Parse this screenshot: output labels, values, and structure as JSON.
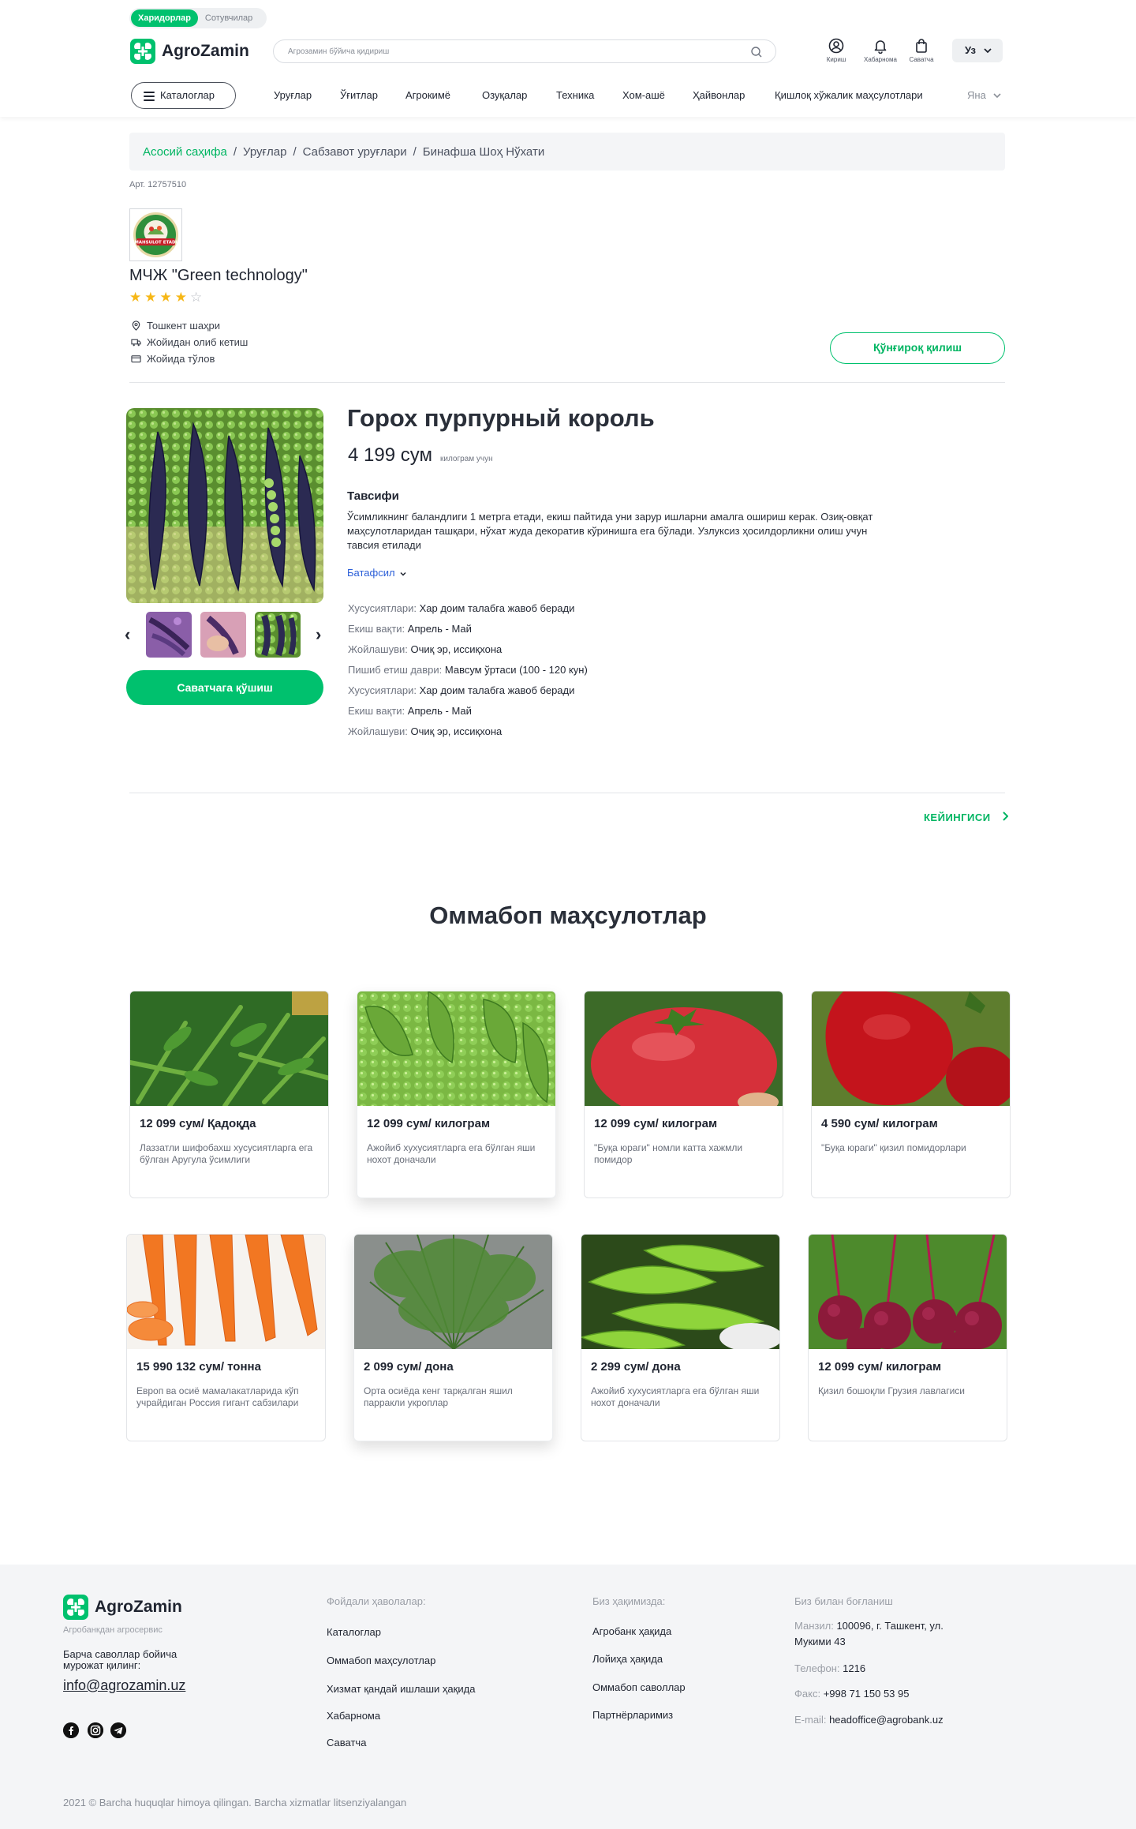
{
  "header": {
    "role_tabs": [
      "Харидорлар",
      "Сотувчилар"
    ],
    "brand": "AgroZamin",
    "search_placeholder": "Агрозамин бўйича қидириш",
    "icons": [
      {
        "icon": "user-icon",
        "label": "Кириш"
      },
      {
        "icon": "bell-icon",
        "label": "Хабарнома"
      },
      {
        "icon": "bag-icon",
        "label": "Саватча"
      }
    ],
    "language": "Уз",
    "catalog_label": "Каталоглар",
    "nav": [
      "Уруғлар",
      "Ўғитлар",
      "Агрокимё",
      "Озуқалар",
      "Техника",
      "Хом-ашё",
      "Ҳайвонлар",
      "Қишлоқ хўжалик маҳсулотлари"
    ],
    "nav_more": "Яна"
  },
  "breadcrumb": [
    "Асосий саҳифа",
    "Уруғлар",
    "Сабзавот уруғлари",
    "Бинафша Шоҳ Нўхати"
  ],
  "article": "Арт. 12757510",
  "seller": {
    "logo_text": "MAHSULOT ETADI",
    "name": "МЧЖ \"Green technology\"",
    "rating": 4,
    "rating_max": 5,
    "info": [
      {
        "icon": "location-icon",
        "text": "Тошкент шаҳри"
      },
      {
        "icon": "truck-icon",
        "text": "Жойидан олиб кетиш"
      },
      {
        "icon": "card-icon",
        "text": "Жойида тўлов"
      }
    ],
    "call_label": "Қўнғироқ қилиш"
  },
  "product": {
    "title": "Горох пурпурный король",
    "price": "4 199 сум",
    "unit": "килограм учун",
    "desc_heading": "Тавсифи",
    "description": "Ўсимликнинг баландлиги 1 метрга етади, екиш пайтида уни зарур ишларни амалга ошириш керак. Озиқ-овқат маҳсулотларидан ташқари, нўхат жуда декоратив кўринишга ега бўлади. Узлуксиз ҳосилдорликни олиш учун тавсия етилади",
    "more_label": "Батафсил",
    "add_to_cart": "Саватчага қўшиш",
    "specs": [
      {
        "k": "Хусусиятлари:",
        "v": "Хар доим талабга жавоб беради"
      },
      {
        "k": "Екиш вақти:",
        "v": "Апрель - Май"
      },
      {
        "k": "Жойлашуви:",
        "v": "Очиқ эр, иссиқхона"
      },
      {
        "k": "Пишиб етиш даври:",
        "v": "Мавсум ўртаси (100 - 120 кун)"
      },
      {
        "k": "Хусусиятлари:",
        "v": "Хар доим талабга жавоб беради"
      },
      {
        "k": "Екиш вақти:",
        "v": "Апрель - Май"
      },
      {
        "k": "Жойлашуви:",
        "v": "Очиқ эр, иссиқхона"
      }
    ],
    "next_label": "КЕЙИНГИСИ"
  },
  "popular": {
    "title": "Оммабоп маҳсулотлар",
    "items": [
      {
        "price": "12 099 сум/ Қадоқда",
        "desc": "Лаззатли шифобахш хусусиятларга ега бўлган Аругула ўсимлиги"
      },
      {
        "price": "12 099 сум/ килограм",
        "desc": "Ажойиб хуxусиятларга ега бўлган яши нохот доначали"
      },
      {
        "price": "12 099 сум/ килограм",
        "desc": "\"Буқа юраги\" номли катта хажмли помидор"
      },
      {
        "price": "4 590 сум/ килограм",
        "desc": "\"Буқа юраги\" қизил помидорлари"
      },
      {
        "price": "15 990 132 сум/ тонна",
        "desc": "Европ ва осиё мамалакатларида кўп учрайдиган Россия гигант сабзилари"
      },
      {
        "price": "2 099 сум/ дона",
        "desc": "Орта осиёда кенг тарқалган яшил парракли укроплар"
      },
      {
        "price": "2 299 сум/ дона",
        "desc": "Ажойиб хуxусиятларга ега бўлган яши нохот доначали"
      },
      {
        "price": "12 099 сум/ килограм",
        "desc": "Қизил бошоқли Грузия лавлагиси"
      }
    ]
  },
  "footer": {
    "brand": "AgroZamin",
    "subtitle": "Агробанкдан агросервис",
    "ask": "Барча саволлар бойича мурожат қилинг:",
    "email": "info@agrozamin.uz",
    "social": [
      "facebook-icon",
      "instagram-icon",
      "telegram-icon"
    ],
    "useful_heading": "Фойдали ҳаволалар:",
    "useful_links": [
      "Каталоглар",
      "Оммабоп маҳсулотлар",
      "Хизмат қандай ишлаши ҳақида",
      "Хабарнома",
      "Саватча"
    ],
    "about_heading": "Биз ҳақимизда:",
    "about_links": [
      "Агробанк ҳақида",
      "Лойиҳа ҳақида",
      "Оммабоп саволлар",
      "Партнёрларимиз"
    ],
    "contact_heading": "Биз билан боғланиш",
    "contacts": [
      {
        "k": "Манзил:",
        "v": "100096, г. Ташкент, ул. Мукими 43"
      },
      {
        "k": "Телефон:",
        "v": "1216"
      },
      {
        "k": "Факс:",
        "v": "+998 71 150 53 95"
      },
      {
        "k": "E-mail:",
        "v": "headoffice@agrobank.uz"
      }
    ],
    "copyright": "2021 © Barcha huquqlar himoya qilingan. Barcha xizmatlar litsenziyalangan"
  },
  "colors": {
    "accent": "#00c16e",
    "link": "#2a5ed8",
    "star": "#f6b716"
  }
}
